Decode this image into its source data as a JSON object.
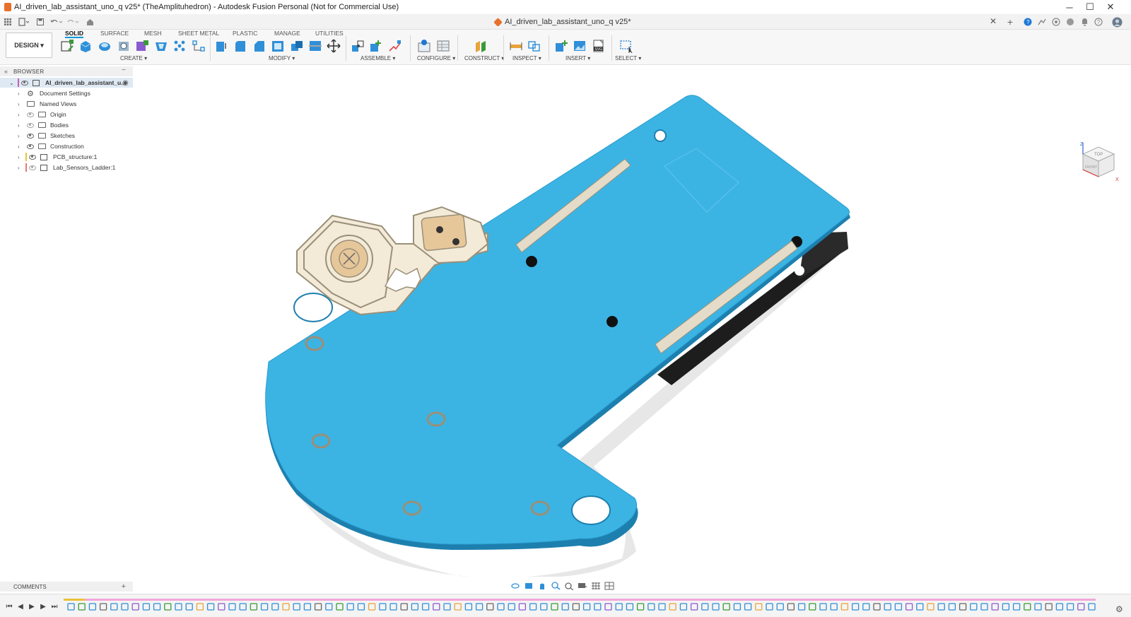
{
  "window": {
    "title": "AI_driven_lab_assistant_uno_q v25* (TheAmplituhedron) - Autodesk Fusion Personal (Not for Commercial Use)",
    "controls": {
      "minimize": "─",
      "maximize": "☐",
      "close": "✕"
    }
  },
  "document_tab": {
    "label": "AI_driven_lab_assistant_uno_q v25*",
    "close": "✕"
  },
  "ribbon": {
    "workspace": "DESIGN ▾",
    "tabs": [
      "SOLID",
      "SURFACE",
      "MESH",
      "SHEET METAL",
      "PLASTIC",
      "MANAGE",
      "UTILITIES"
    ],
    "groups": [
      "CREATE ▾",
      "MODIFY ▾",
      "ASSEMBLE ▾",
      "CONFIGURE ▾",
      "CONSTRUCT ▾",
      "INSPECT ▾",
      "INSERT ▾",
      "SELECT ▾"
    ]
  },
  "browser": {
    "title": "BROWSER",
    "root": "AI_driven_lab_assistant_u...",
    "items": [
      "Document Settings",
      "Named Views",
      "Origin",
      "Bodies",
      "Sketches",
      "Construction",
      "PCB_structure:1",
      "Lab_Sensors_Ladder:1"
    ]
  },
  "comments": {
    "title": "COMMENTS",
    "add": "+"
  },
  "viewcube": {
    "top_label": "TOP",
    "front_label": "FRONT",
    "axis_z": "Z",
    "axis_x": "X"
  },
  "colors": {
    "accent": "#0696d7",
    "board": "#3bb4e4",
    "board_edge": "#1d7fae",
    "rail": "#e4dcc8",
    "sensor_pad": "#e6c79a"
  },
  "timeline": {
    "feature_count": 96
  }
}
